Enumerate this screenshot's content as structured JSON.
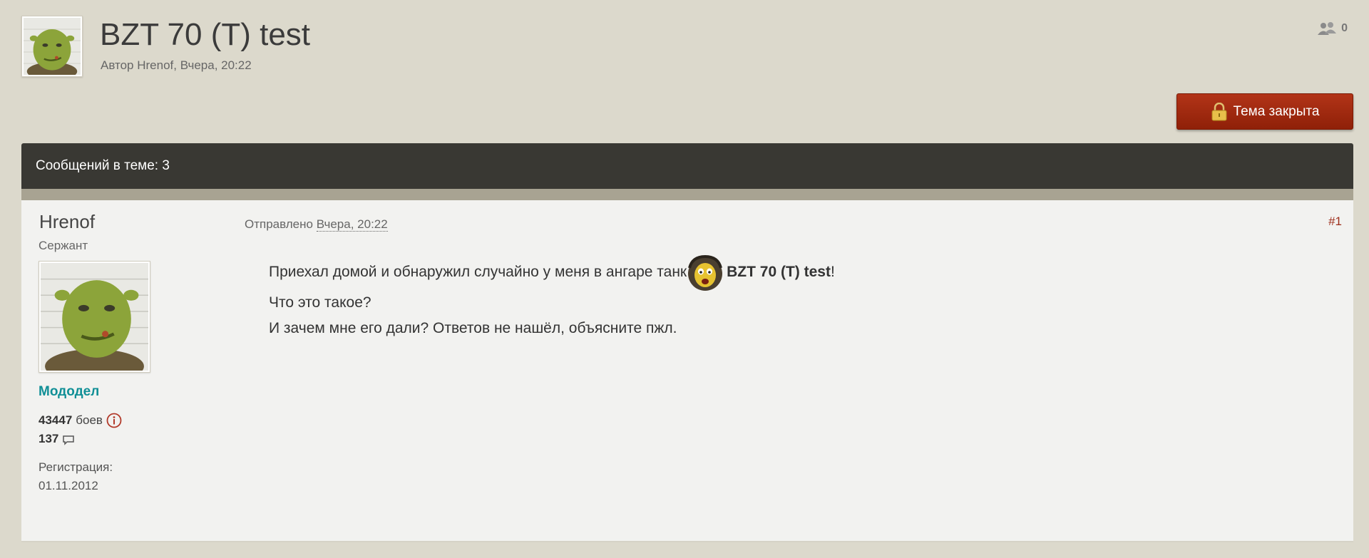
{
  "topic": {
    "title": "BZT 70 (T) test",
    "meta": "Автор Hrenof, Вчера, 20:22",
    "viewers_count": "0",
    "avatar_icon": "shrek-avatar-icon"
  },
  "locked_button": {
    "label": "Тема закрыта",
    "icon": "lock-icon",
    "color": "#a02a10"
  },
  "bar": {
    "posts_count_label": "Сообщений в теме: 3"
  },
  "post": {
    "author": {
      "name": "Hrenof",
      "rank": "Сержант",
      "group": "Мододел",
      "battles_value": "43447",
      "battles_label": "боев",
      "messages_value": "137",
      "registration_label": "Регистрация:",
      "registration_date": "01.11.2012"
    },
    "sent_label": "Отправлено",
    "sent_date": "Вчера, 20:22",
    "number": "#1",
    "body": {
      "line1_text": "Приехал домой и обнаружил случайно у меня в ангаре танк",
      "line1_bold": "BZT 70 (T) test",
      "line1_end": "!",
      "line2": "Что это такое?",
      "line3": "И зачем мне его дали? Ответов не нашёл, объясните пжл."
    }
  },
  "colors": {
    "background": "#dcd9cc",
    "bar": "#393833",
    "group_accent": "#108f96",
    "post_number": "#9d2d1a"
  }
}
